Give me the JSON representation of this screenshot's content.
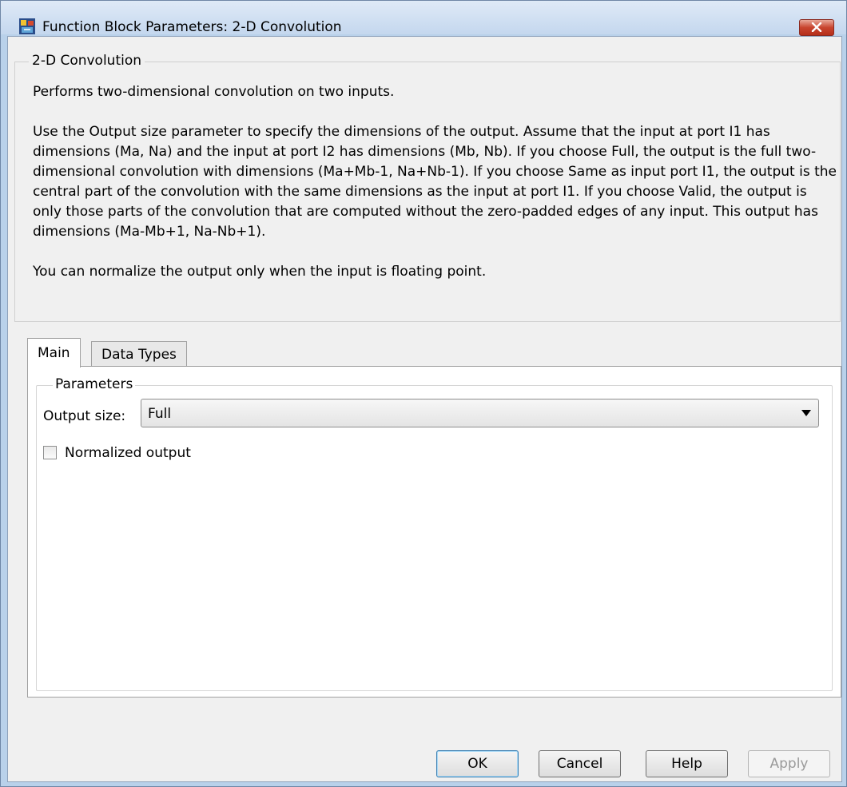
{
  "window": {
    "title": "Function Block Parameters: 2-D Convolution"
  },
  "description": {
    "group_label": "2-D Convolution",
    "paragraphs": [
      "Performs two-dimensional convolution on two inputs.",
      "Use the Output size parameter to specify the dimensions of the output. Assume that the input at port I1 has dimensions (Ma, Na) and the input at port I2 has dimensions (Mb, Nb). If you choose Full, the output is the full two-dimensional convolution with dimensions (Ma+Mb-1, Na+Nb-1). If you choose Same as input port I1, the output is the central part of the convolution with the same dimensions as the input at port I1. If you choose Valid, the output is only those parts of the convolution that are computed without the zero-padded edges of any input. This output has dimensions (Ma-Mb+1, Na-Nb+1).",
      "You can normalize the output only when the input is floating point."
    ]
  },
  "tabs": [
    {
      "label": "Main",
      "active": true
    },
    {
      "label": "Data Types",
      "active": false
    }
  ],
  "parameters": {
    "group_label": "Parameters",
    "output_size_label": "Output size:",
    "output_size_value": "Full",
    "normalized_output_label": "Normalized output",
    "normalized_output_checked": false
  },
  "buttons": {
    "ok": "OK",
    "cancel": "Cancel",
    "help": "Help",
    "apply": "Apply"
  },
  "icons": {
    "app": "simulink-block-icon",
    "close": "close-icon",
    "dropdown": "chevron-down-icon"
  },
  "colors": {
    "close_button": "#c8442e",
    "window_frame": "#b9d1ea",
    "dialog_bg": "#f0f0f0"
  }
}
